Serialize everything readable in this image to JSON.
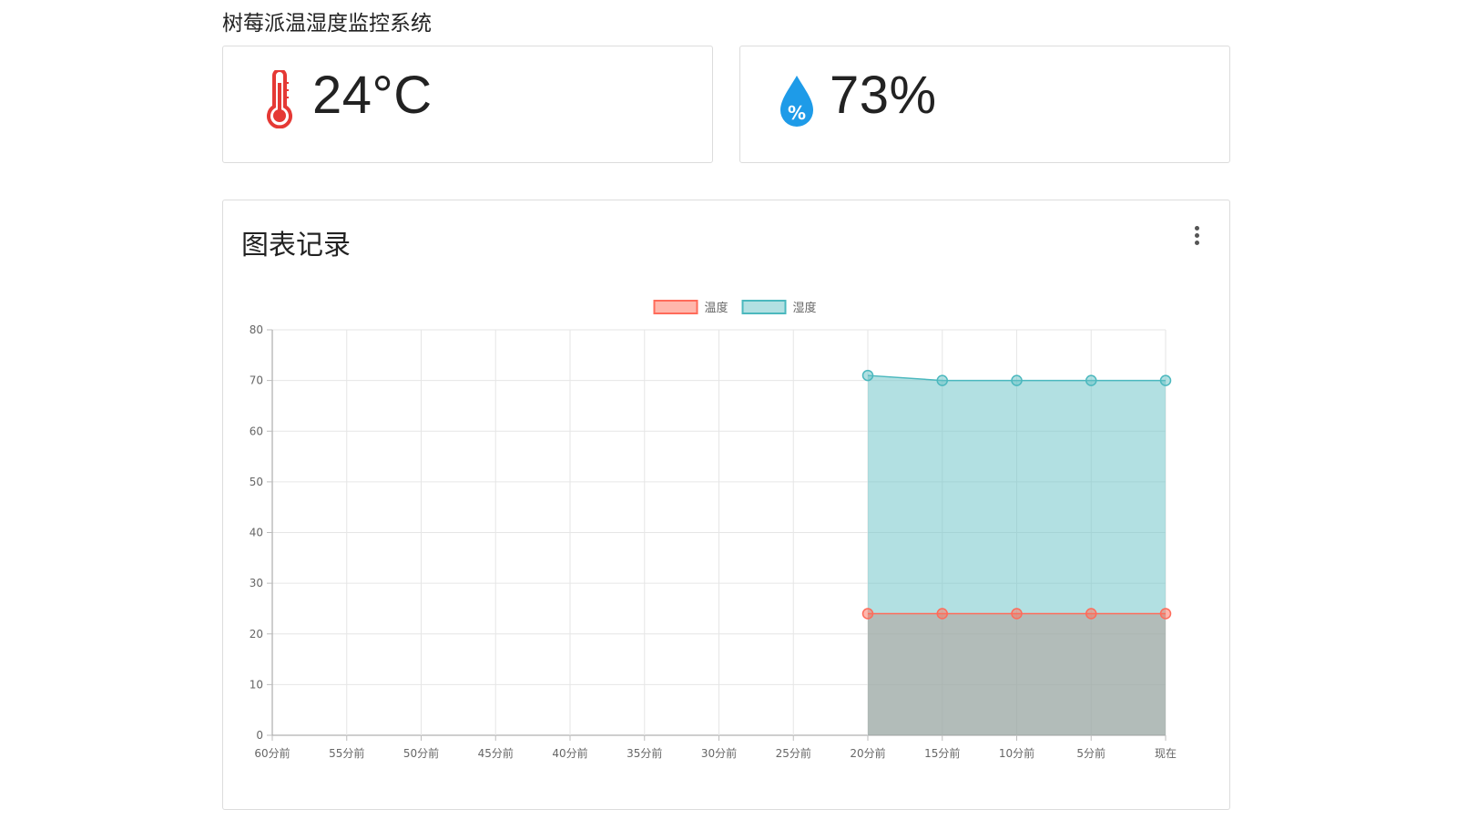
{
  "header": {
    "title": "树莓派温湿度监控系统"
  },
  "temperature": {
    "value": "24°C",
    "icon": "thermometer-icon",
    "color": "#e53935"
  },
  "humidity": {
    "value": "73%",
    "icon": "water-percent-icon",
    "color": "#1e9be8"
  },
  "chart_card": {
    "title": "图表记录",
    "menu_icon": "more-vert-icon"
  },
  "chart_data": {
    "type": "area",
    "categories": [
      "60分前",
      "55分前",
      "50分前",
      "45分前",
      "40分前",
      "35分前",
      "30分前",
      "25分前",
      "20分前",
      "15分前",
      "10分前",
      "5分前",
      "现在"
    ],
    "ylim": [
      0,
      80
    ],
    "yticks": [
      0,
      10,
      20,
      30,
      40,
      50,
      60,
      70,
      80
    ],
    "grid": true,
    "legend": "top-center",
    "series": [
      {
        "name": "温度",
        "values": [
          null,
          null,
          null,
          null,
          null,
          null,
          null,
          null,
          24,
          24,
          24,
          24,
          24
        ],
        "stroke": "#ff6b5a",
        "fill": "rgba(255,112,90,0.5)"
      },
      {
        "name": "湿度",
        "values": [
          null,
          null,
          null,
          null,
          null,
          null,
          null,
          null,
          71,
          70,
          70,
          70,
          70
        ],
        "stroke": "#4bb8be",
        "fill": "rgba(102,193,198,0.5)"
      }
    ]
  }
}
